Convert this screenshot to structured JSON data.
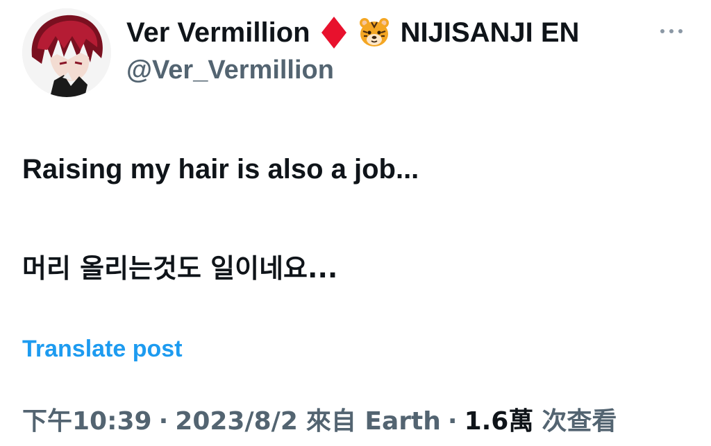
{
  "author": {
    "display_name": "Ver Vermillion",
    "affiliation": "NIJISANJI EN",
    "handle": "@Ver_Vermillion",
    "badge_icons": [
      "red-diamond-icon",
      "tiger-face-icon"
    ],
    "avatar": "avatar"
  },
  "post": {
    "text_en": "Raising my hair is also a job...",
    "text_ko": "머리 올리는것도 일이네요...",
    "translate_label": "Translate post"
  },
  "meta": {
    "time": "下午10:39",
    "separator": "·",
    "date": "2023/8/2",
    "source": "來自 Earth",
    "views_count": "1.6萬",
    "views_label": "次查看"
  },
  "colors": {
    "text": "#0f1419",
    "secondary": "#536471",
    "link": "#1d9bf0",
    "diamond": "#e8112d"
  }
}
